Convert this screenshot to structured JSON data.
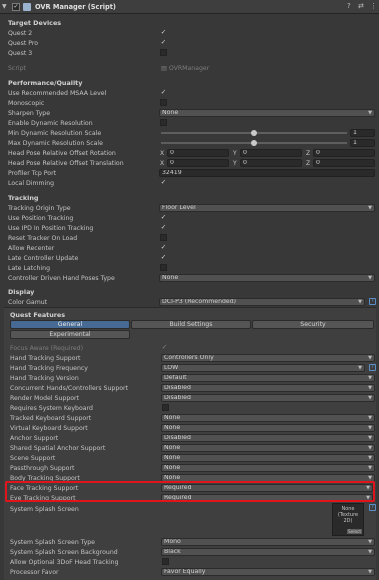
{
  "header": {
    "title": "OVR Manager (Script)"
  },
  "target_devices": {
    "heading": "Target Devices",
    "items": [
      {
        "label": "Quest 2",
        "checked": true
      },
      {
        "label": "Quest Pro",
        "checked": true
      },
      {
        "label": "Quest 3",
        "checked": false
      }
    ]
  },
  "script": {
    "label": "Script",
    "value": "OVRManager"
  },
  "perf": {
    "heading": "Performance/Quality",
    "msaa_label": "Use Recommended MSAA Level",
    "monoscopic_label": "Monoscopic",
    "sharpen_label": "Sharpen Type",
    "sharpen_value": "None",
    "dyn_res_label": "Enable Dynamic Resolution",
    "min_dyn_label": "Min Dynamic Resolution Scale",
    "min_dyn_value": "1",
    "max_dyn_label": "Max Dynamic Resolution Scale",
    "max_dyn_value": "1",
    "rot_label": "Head Pose Relative Offset Rotation",
    "trans_label": "Head Pose Relative Offset Translation",
    "x_label": "X",
    "y_label": "Y",
    "z_label": "Z",
    "zero": "0",
    "tcp_label": "Profiler Tcp Port",
    "tcp_value": "32419",
    "dimming_label": "Local Dimming"
  },
  "tracking": {
    "heading": "Tracking",
    "origin_label": "Tracking Origin Type",
    "origin_value": "Floor Level",
    "pos_label": "Use Position Tracking",
    "ipd_label": "Use IPD In Position Tracking",
    "reset_label": "Reset Tracker On Load",
    "recenter_label": "Allow Recenter",
    "late_ctrl_label": "Late Controller Update",
    "late_latch_label": "Late Latching",
    "cdh_label": "Controller Driven Hand Poses Type",
    "cdh_value": "None"
  },
  "display": {
    "heading": "Display",
    "gamut_label": "Color Gamut",
    "gamut_value": "DCI-P3 (Recommended)"
  },
  "quest": {
    "heading": "Quest Features",
    "tabs": [
      "General",
      "Build Settings",
      "Security",
      "Experimental"
    ],
    "rows": [
      {
        "label": "Focus Aware (Required)",
        "value": ""
      },
      {
        "label": "Hand Tracking Support",
        "value": "Controllers Only"
      },
      {
        "label": "Hand Tracking Frequency",
        "value": "LOW"
      },
      {
        "label": "Hand Tracking Version",
        "value": "Default"
      },
      {
        "label": "Concurrent Hands/Controllers Support",
        "value": "Disabled"
      },
      {
        "label": "Render Model Support",
        "value": "Disabled"
      },
      {
        "label": "Requires System Keyboard",
        "value": ""
      },
      {
        "label": "Tracked Keyboard Support",
        "value": "None"
      },
      {
        "label": "Virtual Keyboard Support",
        "value": "None"
      },
      {
        "label": "Anchor Support",
        "value": "Disabled"
      },
      {
        "label": "Shared Spatial Anchor Support",
        "value": "None"
      },
      {
        "label": "Scene Support",
        "value": "None"
      },
      {
        "label": "Passthrough Support",
        "value": "None"
      },
      {
        "label": "Body Tracking Support",
        "value": "None"
      },
      {
        "label": "Face Tracking Support",
        "value": "Required"
      },
      {
        "label": "Eye Tracking Support",
        "value": "Required"
      }
    ],
    "splash_label": "System Splash Screen",
    "splash_none": "None",
    "splash_type": "(Texture 2D)",
    "splash_select": "Select",
    "splash_type_label": "System Splash Screen Type",
    "splash_type_value": "Mono",
    "splash_bg_label": "System Splash Screen Background",
    "splash_bg_value": "Black",
    "dof_label": "Allow Optional 3DoF Head Tracking",
    "favor_label": "Processor Favor",
    "favor_value": "Favor Equally"
  },
  "colors": {
    "accent_tab": "#466a93",
    "highlight": "#e0151b",
    "help_icon": "#5b8ec9"
  }
}
